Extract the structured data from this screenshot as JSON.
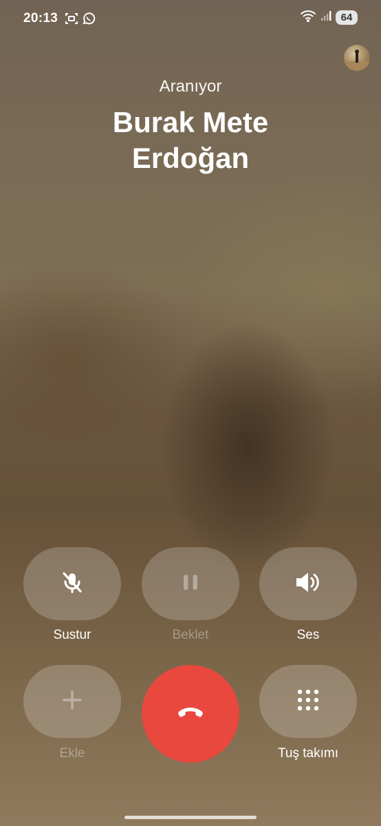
{
  "status_bar": {
    "time": "20:13",
    "battery": "64",
    "icons": [
      "screenshot-icon",
      "whatsapp-icon",
      "wifi-icon",
      "signal-icon",
      "battery-icon"
    ]
  },
  "call": {
    "status": "Aranıyor",
    "contact_name": "Burak Mete Erdoğan"
  },
  "controls": {
    "mute": {
      "label": "Sustur",
      "icon": "mic-off-icon",
      "enabled": true
    },
    "hold": {
      "label": "Beklet",
      "icon": "pause-icon",
      "enabled": false
    },
    "speaker": {
      "label": "Ses",
      "icon": "speaker-icon",
      "enabled": true
    },
    "add": {
      "label": "Ekle",
      "icon": "plus-icon",
      "enabled": false
    },
    "end": {
      "icon": "end-call-icon",
      "color": "#e8483d"
    },
    "keypad": {
      "label": "Tuş takımı",
      "icon": "dialpad-icon",
      "enabled": true
    }
  }
}
